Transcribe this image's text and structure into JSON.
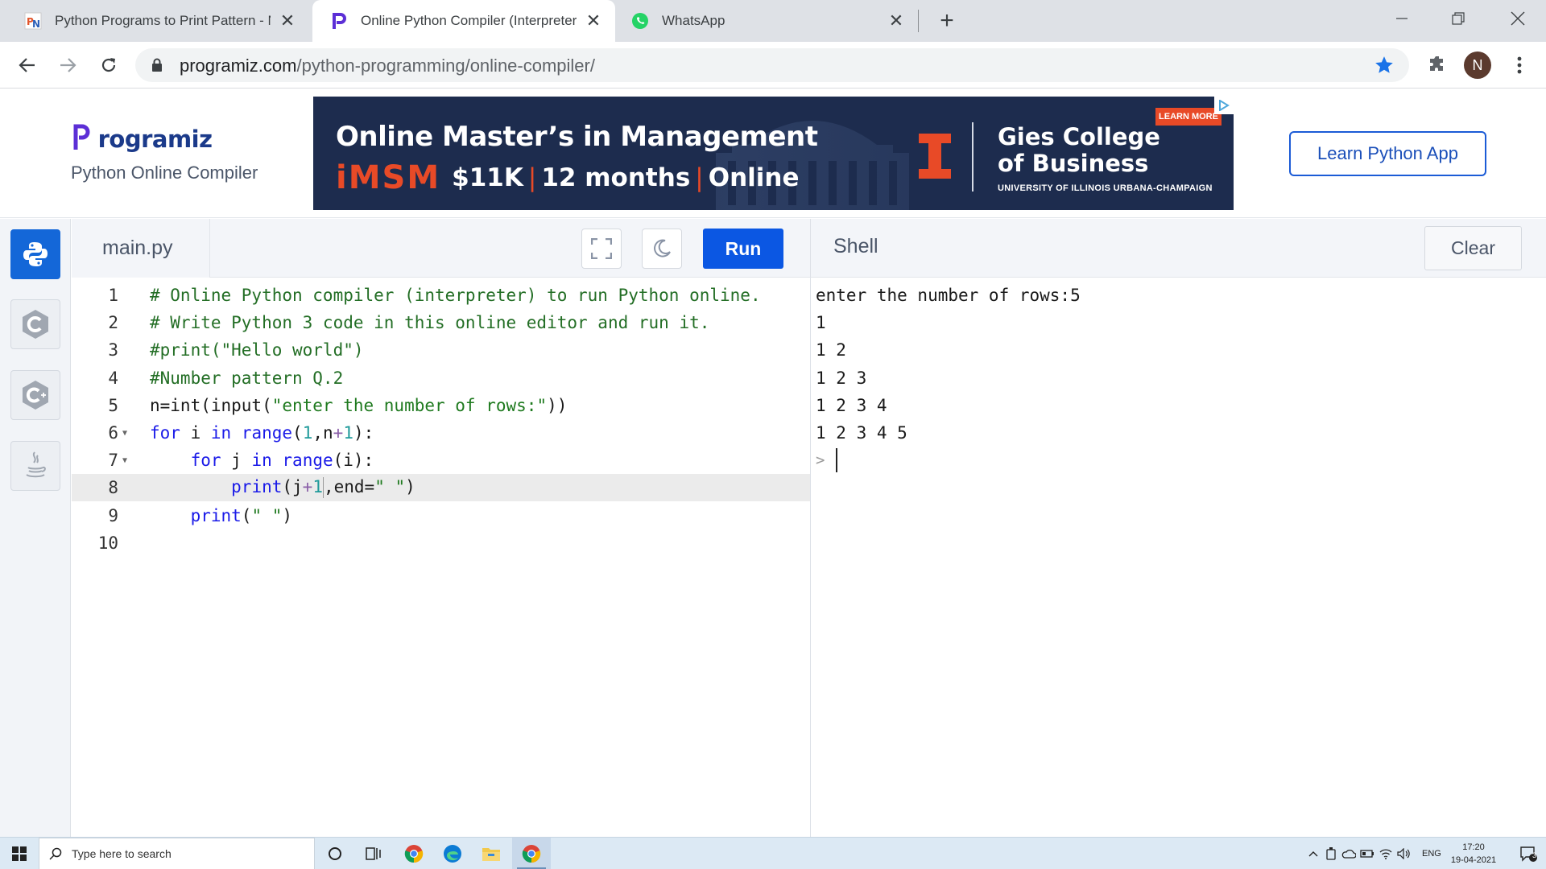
{
  "browser": {
    "tabs": [
      {
        "title": "Python Programs to Print Pattern - N",
        "icon": "pn-favicon"
      },
      {
        "title": "Online Python Compiler (Interpreter",
        "icon": "programiz-favicon"
      },
      {
        "title": "WhatsApp",
        "icon": "whatsapp-favicon"
      }
    ],
    "url_host": "programiz.com",
    "url_path": "/python-programming/online-compiler/",
    "profile_initial": "N"
  },
  "site": {
    "logo_text": "rogramiz",
    "subtitle": "Python Online Compiler",
    "learn_button": "Learn Python App"
  },
  "ad": {
    "headline": "Online Master’s in Management",
    "brand": "iMSM",
    "price": "$11K",
    "duration": "12 months",
    "mode": "Online",
    "school": "Gies College",
    "school2": "of Business",
    "university": "UNIVERSITY OF ILLINOIS URBANA-CHAMPAIGN",
    "cta": "LEARN MORE"
  },
  "rail": {
    "items": [
      "python-icon",
      "c-icon",
      "cpp-icon",
      "java-icon"
    ],
    "active": "python"
  },
  "editor": {
    "filename": "main.py",
    "run_label": "Run",
    "active_line": 8,
    "lines": [
      "# Online Python compiler (interpreter) to run Python online.",
      "# Write Python 3 code in this online editor and run it.",
      "#print(\"Hello world\")",
      "#Number pattern Q.2",
      "n=int(input(\"enter the number of rows:\"))",
      "for i in range(1,n+1):",
      "    for j in range(i):",
      "        print(j+1,end=\" \")",
      "    print(\" \")",
      ""
    ],
    "line_numbers": [
      "1",
      "2",
      "3",
      "4",
      "5",
      "6",
      "7",
      "8",
      "9",
      "10"
    ]
  },
  "shell": {
    "title": "Shell",
    "clear_label": "Clear",
    "output": [
      "enter the number of rows:5",
      "1",
      "1 2",
      "1 2 3",
      "1 2 3 4",
      "1 2 3 4 5"
    ],
    "prompt": ">"
  },
  "taskbar": {
    "search_placeholder": "Type here to search",
    "language": "ENG",
    "time": "17:20",
    "date": "19-04-2021",
    "notification_count": "3"
  },
  "colors": {
    "run_button": "#0b57e3",
    "rail_active": "#1467d8",
    "keyword": "#1a1ae8",
    "comment": "#236e25",
    "ad_accent": "#e84a27"
  }
}
